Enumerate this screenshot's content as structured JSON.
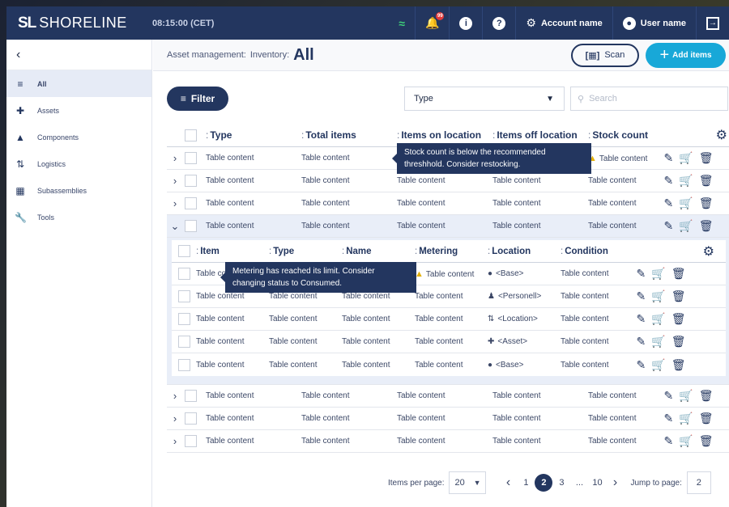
{
  "app": {
    "brand_mark": "SL",
    "brand_name": "SHORELINE",
    "clock": "08:15:00 (CET)",
    "notification_count": "99",
    "account_label": "Account name",
    "user_label": "User name"
  },
  "sidebar": {
    "items": [
      {
        "label": "All",
        "icon": "list-icon"
      },
      {
        "label": "Assets",
        "icon": "plus-icon"
      },
      {
        "label": "Components",
        "icon": "components-icon"
      },
      {
        "label": "Logistics",
        "icon": "logistics-icon"
      },
      {
        "label": "Subassemblies",
        "icon": "grid-icon"
      },
      {
        "label": "Tools",
        "icon": "wrench-icon"
      }
    ]
  },
  "breadcrumb": {
    "part1": "Asset management:",
    "part2": "Inventory:",
    "title": "All"
  },
  "actions": {
    "scan_label": "Scan",
    "add_label": "Add items"
  },
  "toolbar": {
    "filter_label": "Filter",
    "type_value": "Type",
    "search_placeholder": "Search"
  },
  "table": {
    "headers": [
      "Type",
      "Total items",
      "Items on location",
      "Items off location",
      "Stock count"
    ],
    "cell": "Table content"
  },
  "subtable": {
    "headers": [
      "Item",
      "Type",
      "Name",
      "Metering",
      "Location",
      "Condition"
    ],
    "locations": [
      "<Base>",
      "<Personell>",
      "<Location>",
      "<Asset>",
      "<Base>"
    ]
  },
  "tooltips": {
    "stock": "Stock count is below the recommended threshhold. Consider restocking.",
    "metering": "Metering has reached its limit. Consider changing status to Consumed."
  },
  "pagination": {
    "per_page_label": "Items per page:",
    "per_page_value": "20",
    "pages": [
      "1",
      "2",
      "3",
      "...",
      "10"
    ],
    "current_page": "2",
    "jump_label": "Jump to page:",
    "jump_value": "2"
  },
  "colors": {
    "navy": "#23365f",
    "accent": "#18a8d8",
    "warning": "#e3b00a",
    "expanded_bg": "#e9eef8"
  }
}
